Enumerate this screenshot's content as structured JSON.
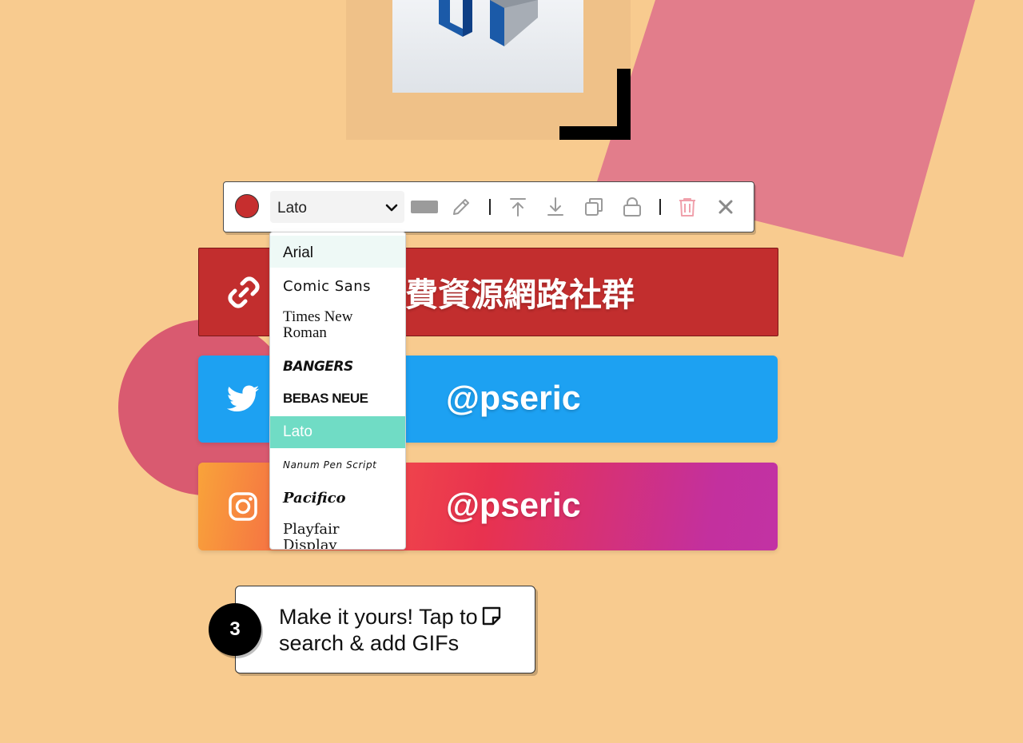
{
  "toolbar": {
    "color": "#c62e2e",
    "font_value": "Lato",
    "icons": [
      "color-swatch",
      "chevron-down-icon",
      "rectangle-icon",
      "pencil-icon",
      "bring-to-front-icon",
      "send-to-back-icon",
      "duplicate-icon",
      "lock-icon",
      "trash-icon",
      "close-icon"
    ]
  },
  "font_dropdown": {
    "options": [
      "Arial",
      "Comic Sans",
      "Times New Roman",
      "Bangers",
      "Bebas Neue",
      "Lato",
      "Nanum Pen Script",
      "Pacifico",
      "Playfair Display"
    ],
    "selected": "Lato",
    "hovered": "Arial"
  },
  "blocks": {
    "link": {
      "text": "費資源網路社群",
      "icon": "link-icon",
      "color": "#c22e2e"
    },
    "twitter": {
      "text": "@pseric",
      "icon": "twitter-icon",
      "color": "#1da1f2"
    },
    "instagram": {
      "text": "@pseric",
      "icon": "instagram-icon"
    }
  },
  "tip": {
    "step": "3",
    "text": "Make it yours! Tap to search & add GIFs",
    "icon": "sticky-note-icon"
  },
  "colors": {
    "background": "#f8cb8f",
    "accent_pink": "#e27d8b",
    "selection": "#70dcc5"
  }
}
